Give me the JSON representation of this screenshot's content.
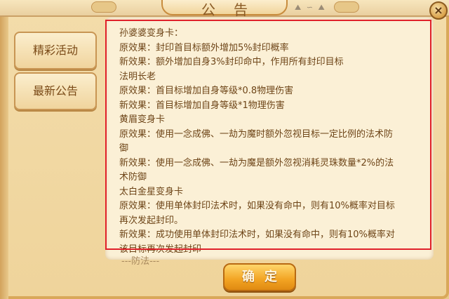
{
  "dialog": {
    "title": "公告",
    "close_label": "×"
  },
  "nav": {
    "items": [
      {
        "label": "精彩活动"
      },
      {
        "label": "最新公告"
      }
    ]
  },
  "announcement": {
    "lines": [
      "孙婆婆变身卡：",
      "原效果：封印首目标额外增加5%封印概率",
      "新效果：额外增加自身3%封印命中，作用所有封印目标",
      "法明长老",
      "原效果：首目标增加自身等级*0.8物理伤害",
      "新效果：首目标增加自身等级*1物理伤害",
      "黄眉变身卡",
      "原效果：使用一念成佛、一劫为魔时额外忽视目标一定比例的法术防\n御",
      "新效果：使用一念成佛、一劫为魔是额外忽视消耗灵珠数量*2%的法\n术防御",
      "太白金星变身卡",
      "原效果：使用单体封印法术时，如果没有命中，则有10%概率对目标\n再次发起封印。",
      "新效果：成功使用单体封印法术时，如果没有命中，则有10%概率对\n该目标再次发起封印"
    ],
    "trailing": "---防法---"
  },
  "footer": {
    "confirm_label": "确定"
  }
}
